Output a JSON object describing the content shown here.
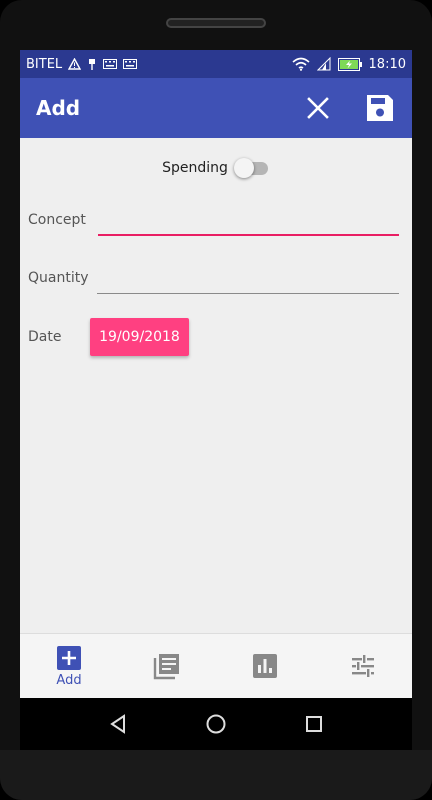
{
  "status": {
    "carrier": "BITEL",
    "time": "18:10",
    "icons": [
      "warning-icon",
      "usb-icon",
      "keyboard-icon",
      "keyboard-icon",
      "wifi-icon",
      "signal-icon",
      "battery-charging-icon"
    ]
  },
  "appbar": {
    "title": "Add",
    "actions": [
      "close-icon",
      "save-icon"
    ]
  },
  "form": {
    "switch": {
      "label": "Spending",
      "on": false
    },
    "concept": {
      "label": "Concept",
      "value": ""
    },
    "quantity": {
      "label": "Quantity",
      "value": ""
    },
    "date": {
      "label": "Date",
      "value": "19/09/2018"
    }
  },
  "bottom_nav": {
    "items": [
      {
        "icon": "add-box-icon",
        "label": "Add",
        "active": true
      },
      {
        "icon": "list-icon",
        "label": "",
        "active": false
      },
      {
        "icon": "chart-icon",
        "label": "",
        "active": false
      },
      {
        "icon": "tune-icon",
        "label": "",
        "active": false
      }
    ]
  },
  "colors": {
    "primary": "#3f51b5",
    "status_bar": "#2b3990",
    "accent": "#ff4081",
    "underline_active": "#e91e63"
  }
}
